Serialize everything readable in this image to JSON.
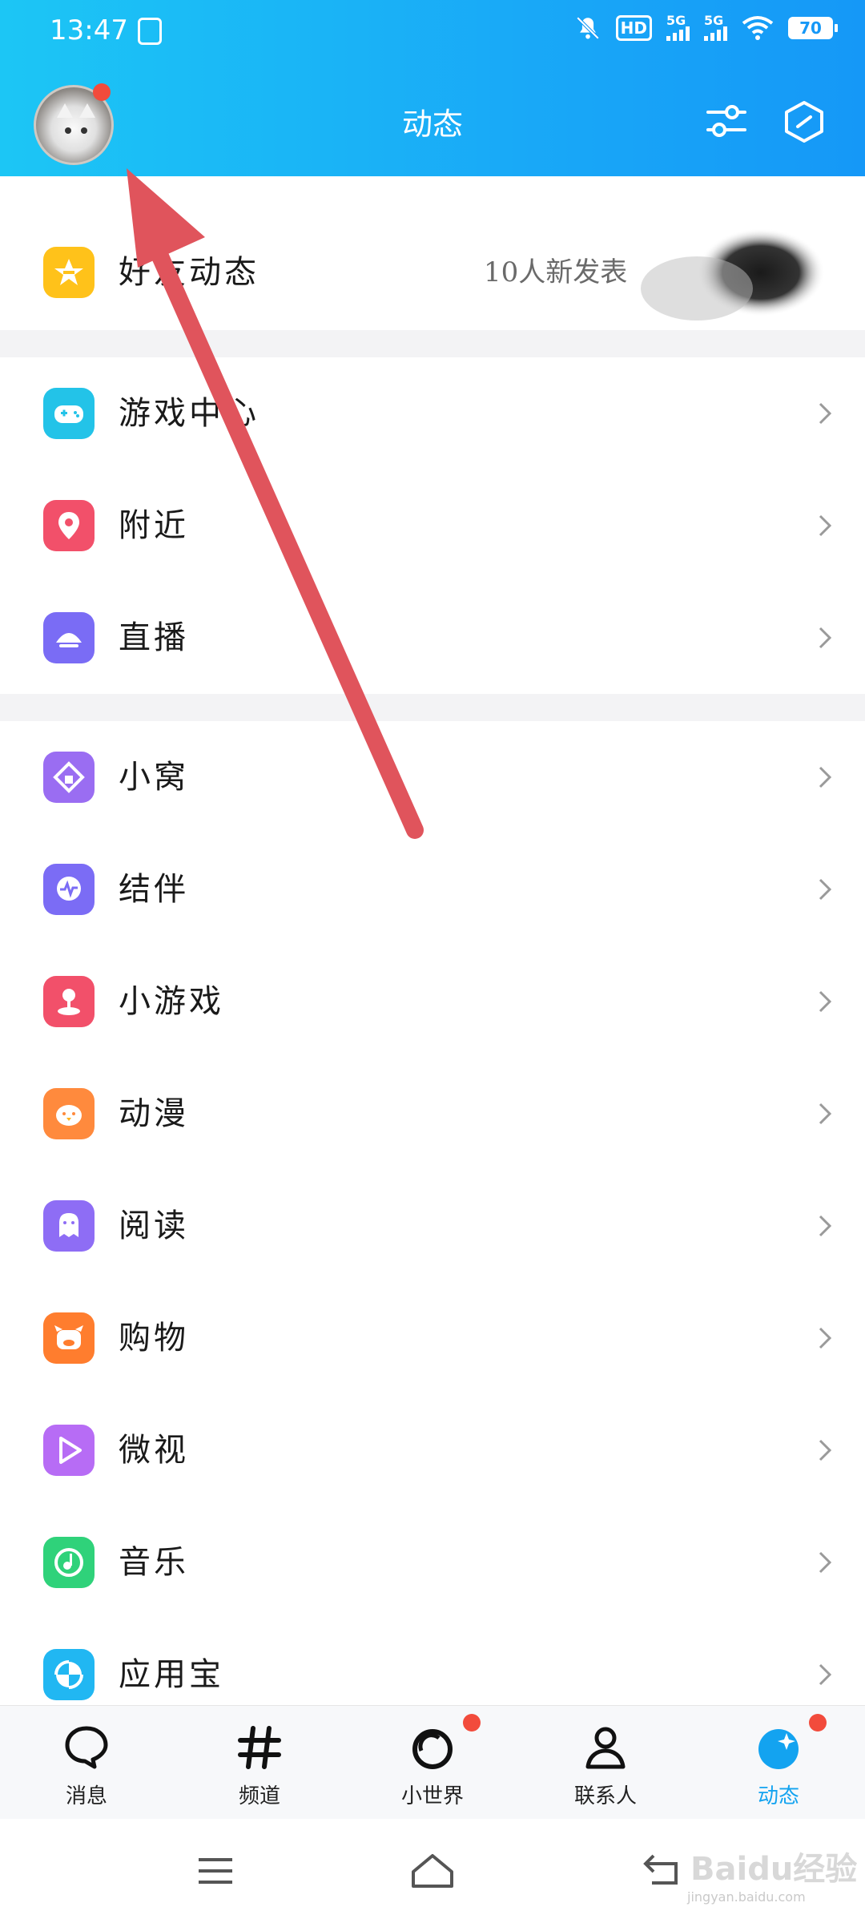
{
  "status_bar": {
    "time": "13:47",
    "hd_label": "HD",
    "signal1": "5G",
    "signal2": "5G",
    "battery": "70"
  },
  "header": {
    "title": "动态"
  },
  "friends_feed": {
    "label": "好友动态",
    "meta": "10人新发表"
  },
  "section1": [
    {
      "label": "游戏中心",
      "icon": "gamepad-icon",
      "color": "#23c3e8"
    },
    {
      "label": "附近",
      "icon": "location-pin-icon",
      "color": "#f2506a"
    },
    {
      "label": "直播",
      "icon": "live-icon",
      "color": "#7a6cf5"
    }
  ],
  "section2": [
    {
      "label": "小窝",
      "icon": "home-diamond-icon",
      "color": "#9a6df2"
    },
    {
      "label": "结伴",
      "icon": "chat-wave-icon",
      "color": "#7b6cf5"
    },
    {
      "label": "小游戏",
      "icon": "joystick-icon",
      "color": "#f2506a"
    },
    {
      "label": "动漫",
      "icon": "cartoon-face-icon",
      "color": "#ff8a3d"
    },
    {
      "label": "阅读",
      "icon": "reading-icon",
      "color": "#8e6df5"
    },
    {
      "label": "购物",
      "icon": "shopping-icon",
      "color": "#ff7d2e"
    },
    {
      "label": "微视",
      "icon": "play-icon",
      "color": "#b76cf5"
    },
    {
      "label": "音乐",
      "icon": "music-icon",
      "color": "#2fd27a"
    },
    {
      "label": "应用宝",
      "icon": "app-store-icon",
      "color": "#21b7f2"
    }
  ],
  "tabbar": [
    {
      "label": "消息",
      "icon": "message-icon",
      "badge": false,
      "active": false
    },
    {
      "label": "频道",
      "icon": "hashtag-icon",
      "badge": false,
      "active": false
    },
    {
      "label": "小世界",
      "icon": "world-icon",
      "badge": true,
      "active": false
    },
    {
      "label": "联系人",
      "icon": "contacts-icon",
      "badge": false,
      "active": false
    },
    {
      "label": "动态",
      "icon": "dynamic-icon",
      "badge": true,
      "active": true
    }
  ],
  "watermark": {
    "brand": "Baidu经验",
    "url": "jingyan.baidu.com"
  },
  "colors": {
    "header_start": "#1cc6f5",
    "header_end": "#1598f7",
    "badge": "#f24b3c",
    "active_tab": "#13a3f0",
    "arrow": "#e0545c"
  }
}
